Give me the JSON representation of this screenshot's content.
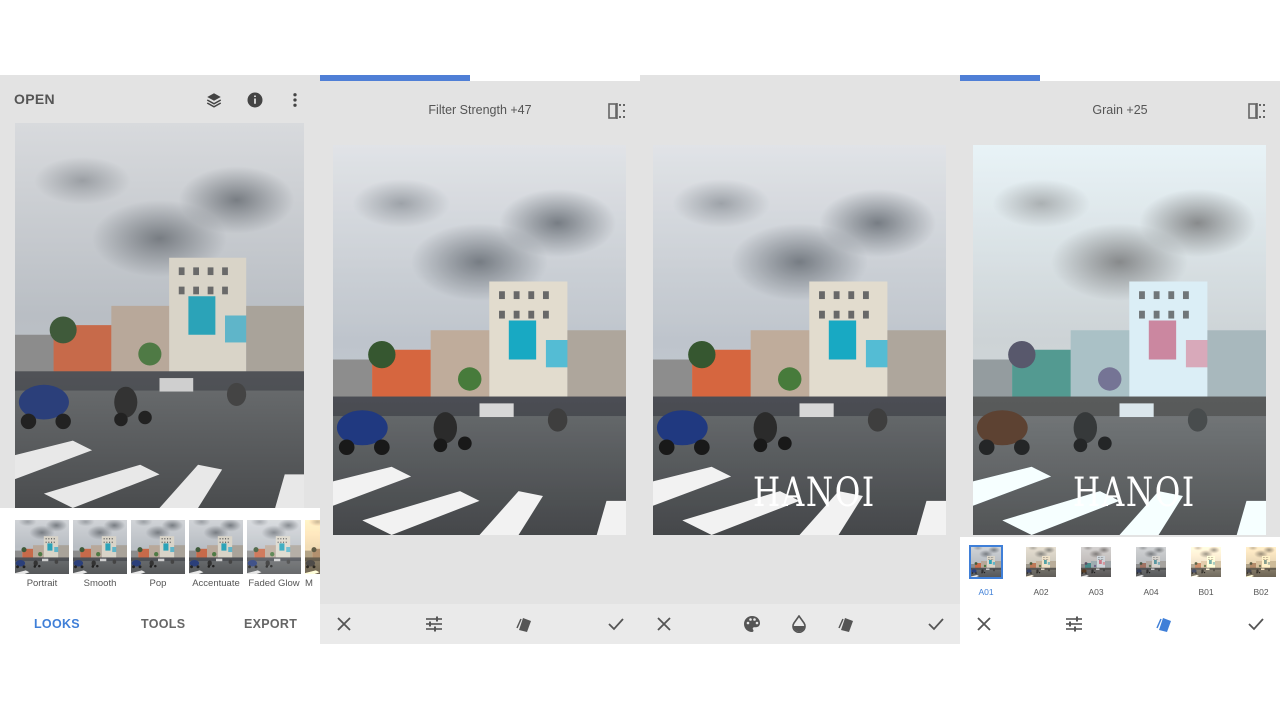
{
  "panel1": {
    "open_label": "OPEN",
    "icons": [
      "layers-icon",
      "info-icon",
      "more-vert-icon"
    ],
    "looks": [
      "Portrait",
      "Smooth",
      "Pop",
      "Accentuate",
      "Faded Glow",
      "M"
    ],
    "tabs": {
      "looks": "LOOKS",
      "tools": "TOOLS",
      "export": "EXPORT"
    },
    "active_tab": "LOOKS"
  },
  "panel2": {
    "param_text": "Filter Strength +47",
    "progress": 0.47
  },
  "panel3": {
    "overlay_text": "HANOI"
  },
  "panel4": {
    "param_text": "Grain +25",
    "progress": 0.25,
    "overlay_text": "HANOI",
    "grain_styles": [
      "A01",
      "A02",
      "A03",
      "A04",
      "B01",
      "B02"
    ],
    "selected_style": "A01"
  },
  "colors": {
    "accent": "#3f7fd8",
    "panel_bg": "#e3e3e3"
  }
}
